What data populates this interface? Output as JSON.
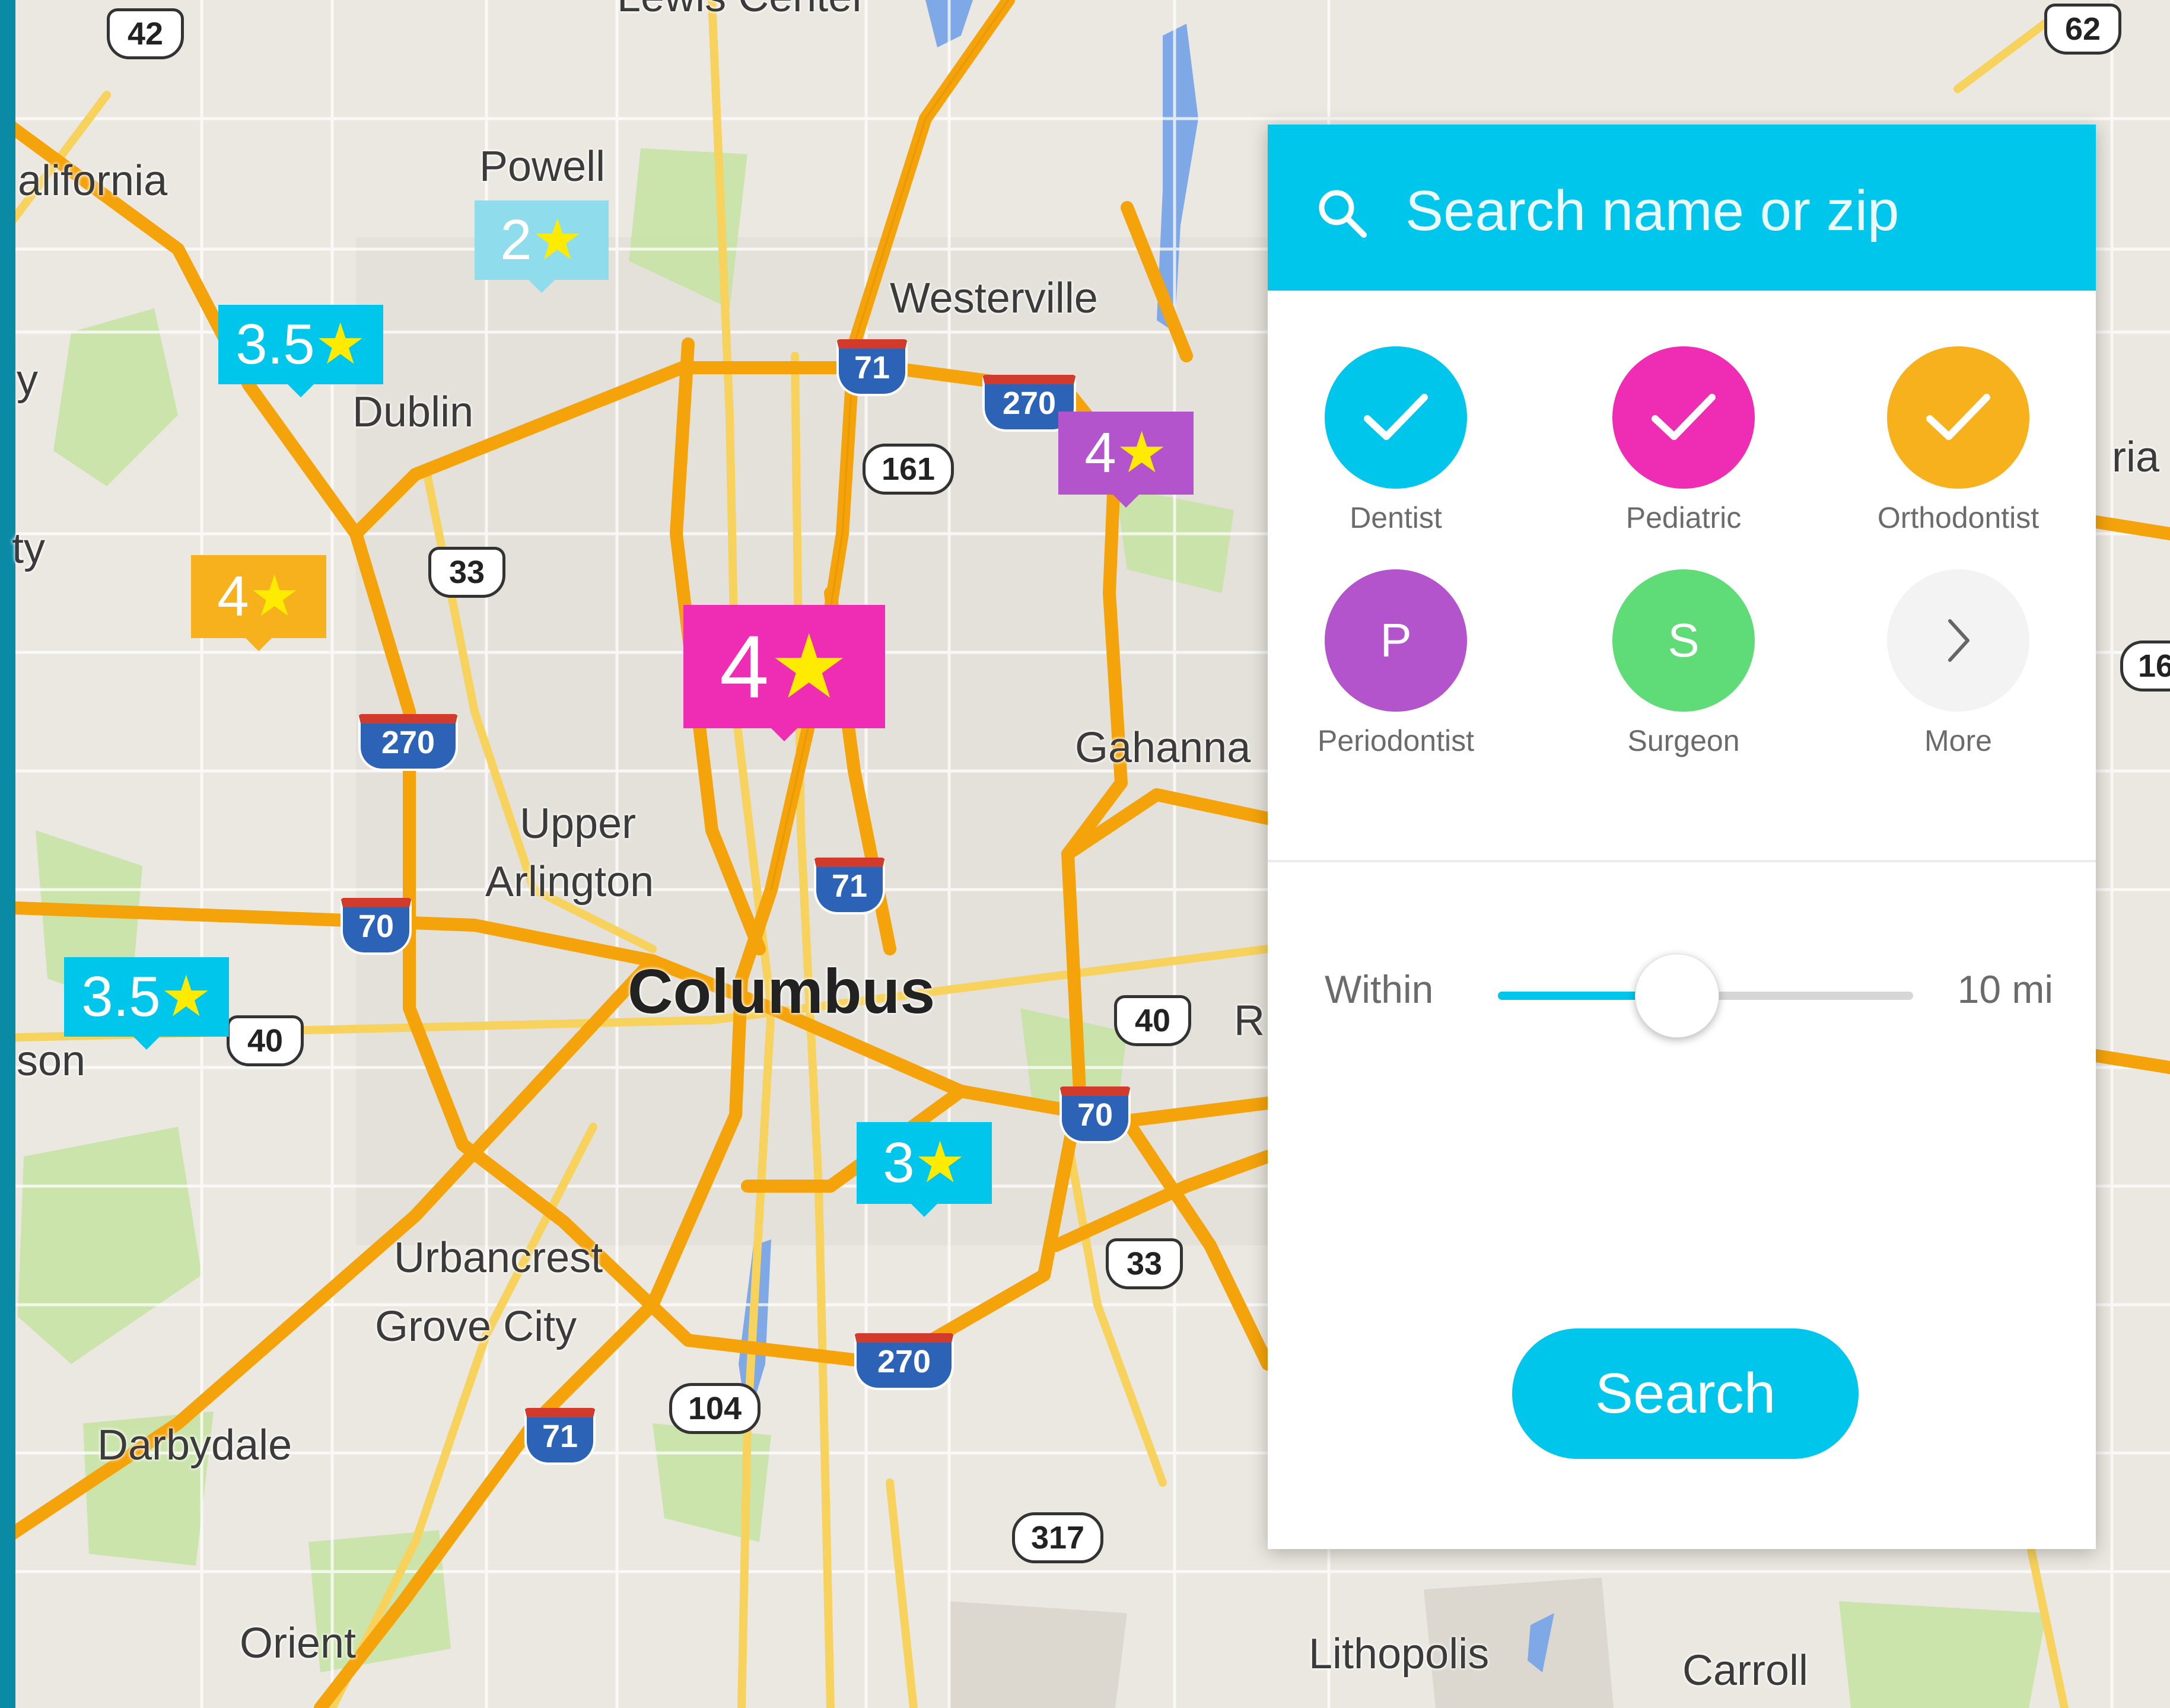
{
  "map": {
    "places": {
      "lewis_center": "Lewis Center",
      "powell": "Powell",
      "westerville": "Westerville",
      "dublin": "Dublin",
      "upper": "Upper",
      "arlington": "Arlington",
      "columbus": "Columbus",
      "gahanna": "Gahanna",
      "urbancrest": "Urbancrest",
      "grove_city": "Grove City",
      "darbydale": "Darbydale",
      "orient": "Orient",
      "lithopolis": "Lithopolis",
      "carroll": "Carroll",
      "california_partial": "alifornia",
      "right_partial": "ria",
      "son_partial": "son",
      "y_partial_1": "y",
      "y_partial_2": "ty",
      "r_partial": "R"
    },
    "routes": {
      "us42": "42",
      "us62": "62",
      "i71_n": "71",
      "i270_ne": "270",
      "sr161": "161",
      "us33_w": "33",
      "i270_w": "270",
      "i71_c": "71",
      "i70_w": "70",
      "us40_w": "40",
      "us40_e": "40",
      "i70_e": "70",
      "us33_e": "33",
      "i270_s": "270",
      "sr104": "104",
      "i71_s": "71",
      "sr317": "317",
      "partial_16": "16"
    },
    "markers": [
      {
        "value": "2",
        "color": "#8fdcec"
      },
      {
        "value": "3.5",
        "color": "#00c6ec"
      },
      {
        "value": "4",
        "color": "#b454cc"
      },
      {
        "value": "4",
        "color": "#f6b11c"
      },
      {
        "value": "4",
        "color": "#ee2db4"
      },
      {
        "value": "3.5",
        "color": "#00c6ec"
      },
      {
        "value": "3",
        "color": "#00c6ec"
      }
    ],
    "star_glyph": "★"
  },
  "panel": {
    "search": {
      "placeholder": "Search name or zip",
      "icon": "search-icon"
    },
    "categories": [
      {
        "label": "Dentist",
        "color": "#00c6ec",
        "state": "checked",
        "icon": "check-icon"
      },
      {
        "label": "Pediatric",
        "color": "#ee2db4",
        "state": "checked",
        "icon": "check-icon"
      },
      {
        "label": "Orthodontist",
        "color": "#f6b11c",
        "state": "checked",
        "icon": "check-icon"
      },
      {
        "label": "Periodontist",
        "color": "#b454cc",
        "state": "unchecked",
        "letter": "P"
      },
      {
        "label": "Surgeon",
        "color": "#5fdc78",
        "state": "unchecked",
        "letter": "S"
      },
      {
        "label": "More",
        "color": "#f3f3f3",
        "icon": "chevron-right-icon"
      }
    ],
    "distance": {
      "label": "Within",
      "value": "10 mi",
      "slider_fraction": 0.5
    },
    "search_button": "Search"
  }
}
